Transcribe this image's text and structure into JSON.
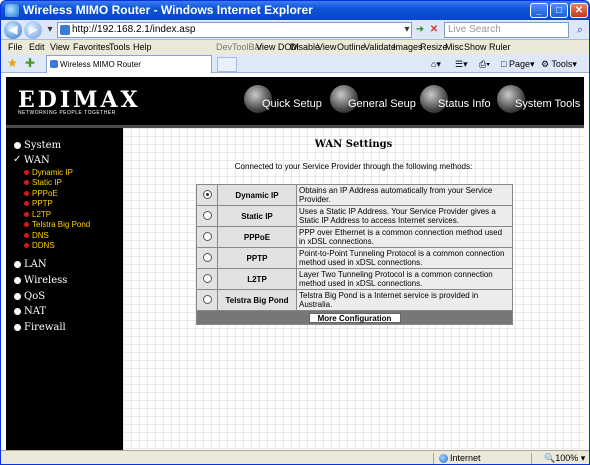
{
  "window": {
    "title": "Wireless MIMO Router - Windows Internet Explorer"
  },
  "addressbar": {
    "url": "http://192.168.2.1/index.asp",
    "search_placeholder": "Live Search"
  },
  "menu": {
    "items": [
      "File",
      "Edit",
      "View",
      "Favorites",
      "Tools",
      "Help"
    ],
    "dev_label": "DevToolBar",
    "dev_items": [
      "View DOM",
      "Disable",
      "View",
      "Outline",
      "Validate",
      "Images",
      "Resize",
      "Misc",
      "Show Ruler"
    ]
  },
  "tab": {
    "title": "Wireless MIMO Router"
  },
  "toolbar": {
    "page_label": "Page",
    "tools_label": "Tools"
  },
  "banner": {
    "logo": "EDIMAX",
    "tagline": "NETWORKING PEOPLE TOGETHER",
    "nav": [
      "Quick Setup",
      "General Seup",
      "Status Info",
      "System Tools"
    ]
  },
  "sidebar": {
    "items": [
      "System",
      "WAN",
      "LAN",
      "Wireless",
      "QoS",
      "NAT",
      "Firewall"
    ],
    "wan_subitems": [
      "Dynamic IP",
      "Static IP",
      "PPPoE",
      "PPTP",
      "L2TP",
      "Telstra Big Pond",
      "DNS",
      "DDNS"
    ]
  },
  "main": {
    "title": "WAN Settings",
    "intro": "Connected to your Service Provider through the following methods:",
    "methods": [
      {
        "name": "Dynamic IP",
        "desc": "Obtains an IP Address automatically from your Service Provider.",
        "selected": true
      },
      {
        "name": "Static IP",
        "desc": "Uses a Static IP Address. Your Service Provider gives a Static IP Address to access Internet services.",
        "selected": false
      },
      {
        "name": "PPPoE",
        "desc": "PPP over Ethernet is a common connection method used in xDSL connections.",
        "selected": false
      },
      {
        "name": "PPTP",
        "desc": "Point-to-Point Tunneling Protocol is a common connection method used in xDSL connections.",
        "selected": false
      },
      {
        "name": "L2TP",
        "desc": "Layer Two Tunneling Protocol is a common connection method used in xDSL connections.",
        "selected": false
      },
      {
        "name": "Telstra Big Pond",
        "desc": "Telstra Big Pond is a Internet service is provided in Australia.",
        "selected": false
      }
    ],
    "more_config_label": "More Configuration"
  },
  "statusbar": {
    "zone": "Internet",
    "zoom": "100%"
  }
}
